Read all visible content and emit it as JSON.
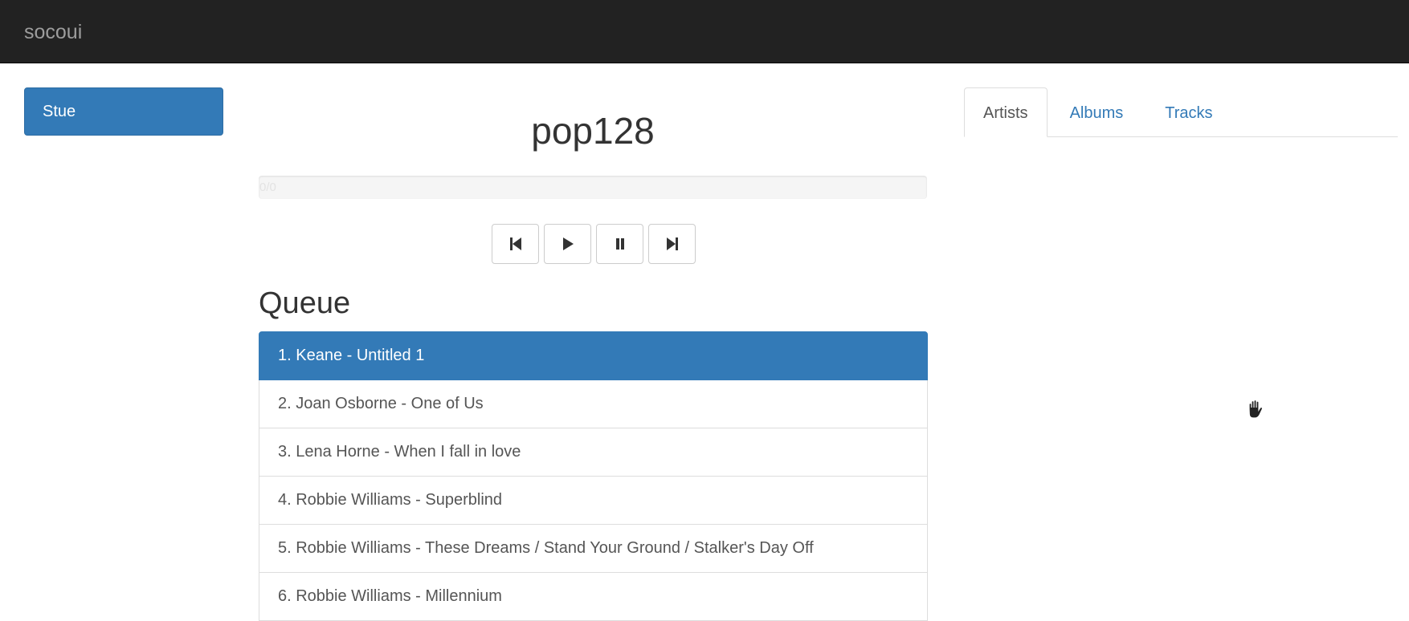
{
  "navbar": {
    "brand": "socoui"
  },
  "sidebar": {
    "room": "Stue"
  },
  "player": {
    "station": "pop128",
    "progress_text": "0/0",
    "progress_fraction": 0,
    "controls": [
      {
        "name": "previous",
        "icon": "step-backward-icon"
      },
      {
        "name": "play",
        "icon": "play-icon"
      },
      {
        "name": "pause",
        "icon": "pause-icon"
      },
      {
        "name": "next",
        "icon": "step-forward-icon"
      }
    ]
  },
  "queue": {
    "heading": "Queue",
    "items": [
      "1. Keane - Untitled 1",
      "2. Joan Osborne - One of Us",
      "3. Lena Horne - When I fall in love",
      "4. Robbie Williams - Superblind",
      "5. Robbie Williams - These Dreams / Stand Your Ground / Stalker's Day Off",
      "6. Robbie Williams - Millennium"
    ],
    "active_index": 0
  },
  "library": {
    "tabs": [
      "Artists",
      "Albums",
      "Tracks"
    ],
    "active_tab": 0
  },
  "colors": {
    "navbar": "#222222",
    "brand": "#9d9d9d",
    "primary": "#337ab7",
    "border": "#dddddd",
    "text": "#333333"
  }
}
